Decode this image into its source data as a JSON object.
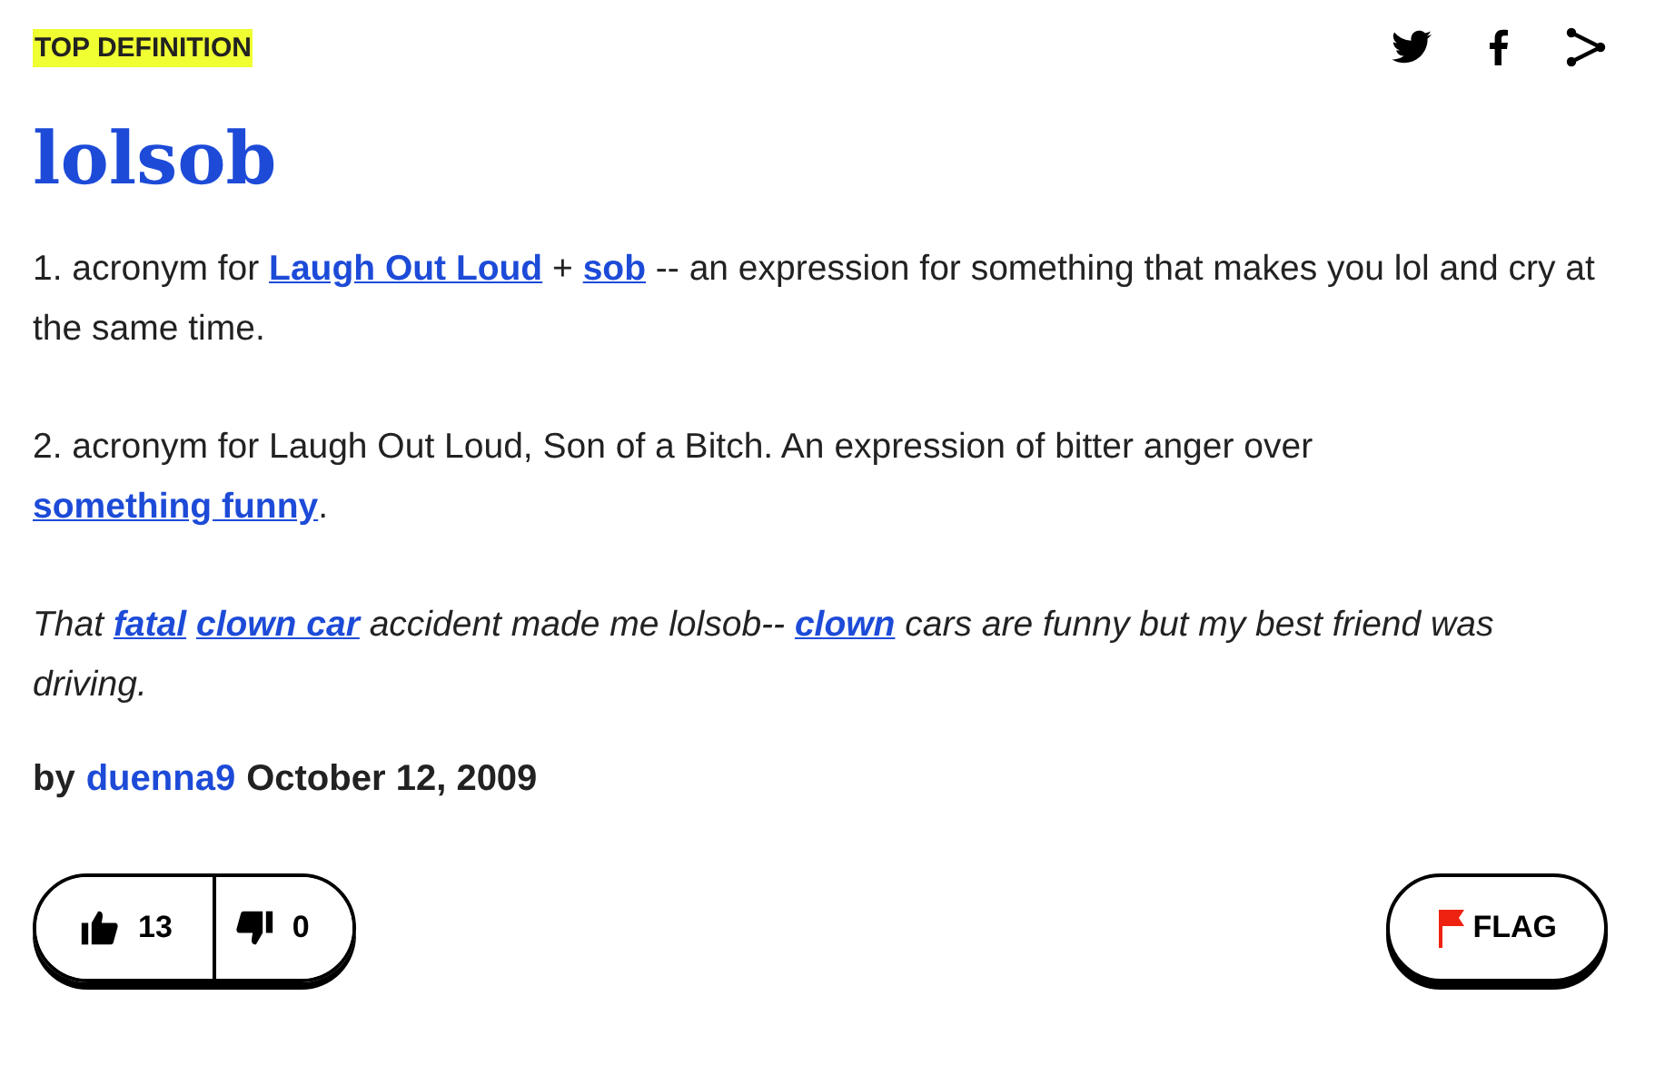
{
  "badge": "TOP DEFINITION",
  "share": [
    {
      "kind": "twitter"
    },
    {
      "kind": "facebook"
    },
    {
      "kind": "share"
    }
  ],
  "word": "lolsob",
  "meaning": [
    [
      {
        "kind": "text",
        "text": "1. acronym for "
      },
      {
        "kind": "link",
        "text": "Laugh Out Loud"
      },
      {
        "kind": "text",
        "text": " + "
      },
      {
        "kind": "link",
        "text": "sob"
      },
      {
        "kind": "text",
        "text": " -- an expression for something that makes you lol and cry at the same time."
      }
    ],
    [
      {
        "kind": "text",
        "text": "2. acronym for Laugh Out Loud, Son of a Bitch. An expression of bitter anger over "
      },
      {
        "kind": "link",
        "text": "something funny"
      },
      {
        "kind": "text",
        "text": "."
      }
    ]
  ],
  "example": [
    {
      "kind": "text",
      "text": "That "
    },
    {
      "kind": "link",
      "text": "fatal"
    },
    {
      "kind": "link",
      "text": "clown car"
    },
    {
      "kind": "text",
      "text": " accident made me lolsob-- "
    },
    {
      "kind": "link",
      "text": "clown"
    },
    {
      "kind": "text",
      "text": " cars are funny but my best friend was driving."
    }
  ],
  "byline": {
    "by": "by",
    "author": "duenna9",
    "date": "October 12, 2009"
  },
  "votes": {
    "up": "13",
    "down": "0"
  },
  "flag": "FLAG"
}
